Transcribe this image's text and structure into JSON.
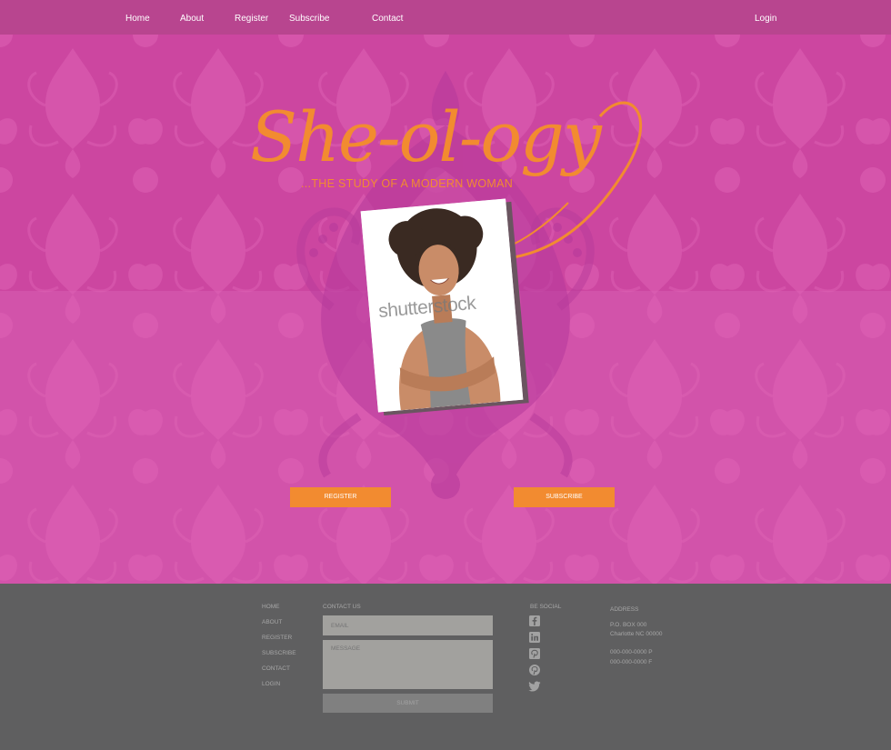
{
  "nav": {
    "items": [
      "Home",
      "About",
      "Register",
      "Subscribe",
      "Contact"
    ],
    "login": "Login"
  },
  "hero": {
    "title": "She-ol-ogy",
    "tagline": "...THE STUDY OF A MODERN WOMAN",
    "watermark": "shutterstock",
    "register_button": "REGISTER",
    "subscribe_button": "SUBSCRIBE"
  },
  "footer": {
    "links": [
      "HOME",
      "ABOUT",
      "REGISTER",
      "SUBSCRIBE",
      "CONTACT",
      "LOGIN"
    ],
    "contact_heading": "CONTACT US",
    "email_placeholder": "EMAIL",
    "message_placeholder": "MESSAGE",
    "submit": "SUBMIT",
    "social_heading": "BE SOCIAL",
    "social_icons": [
      "facebook-icon",
      "linkedin-icon",
      "pinterest-square-icon",
      "pinterest-icon",
      "twitter-icon"
    ],
    "address_heading": "ADDRESS",
    "address_line1": "P.O. BOX 000",
    "address_line2": "Charlotte NC 00000",
    "phone": "000-000-0000 P",
    "fax": "000-000-0000 F"
  },
  "colors": {
    "nav": "#b8458f",
    "hero_upper": "#cc46a0",
    "hero_lower": "#d253aa",
    "accent_orange": "#f28b30",
    "footer": "#5f5f60"
  }
}
